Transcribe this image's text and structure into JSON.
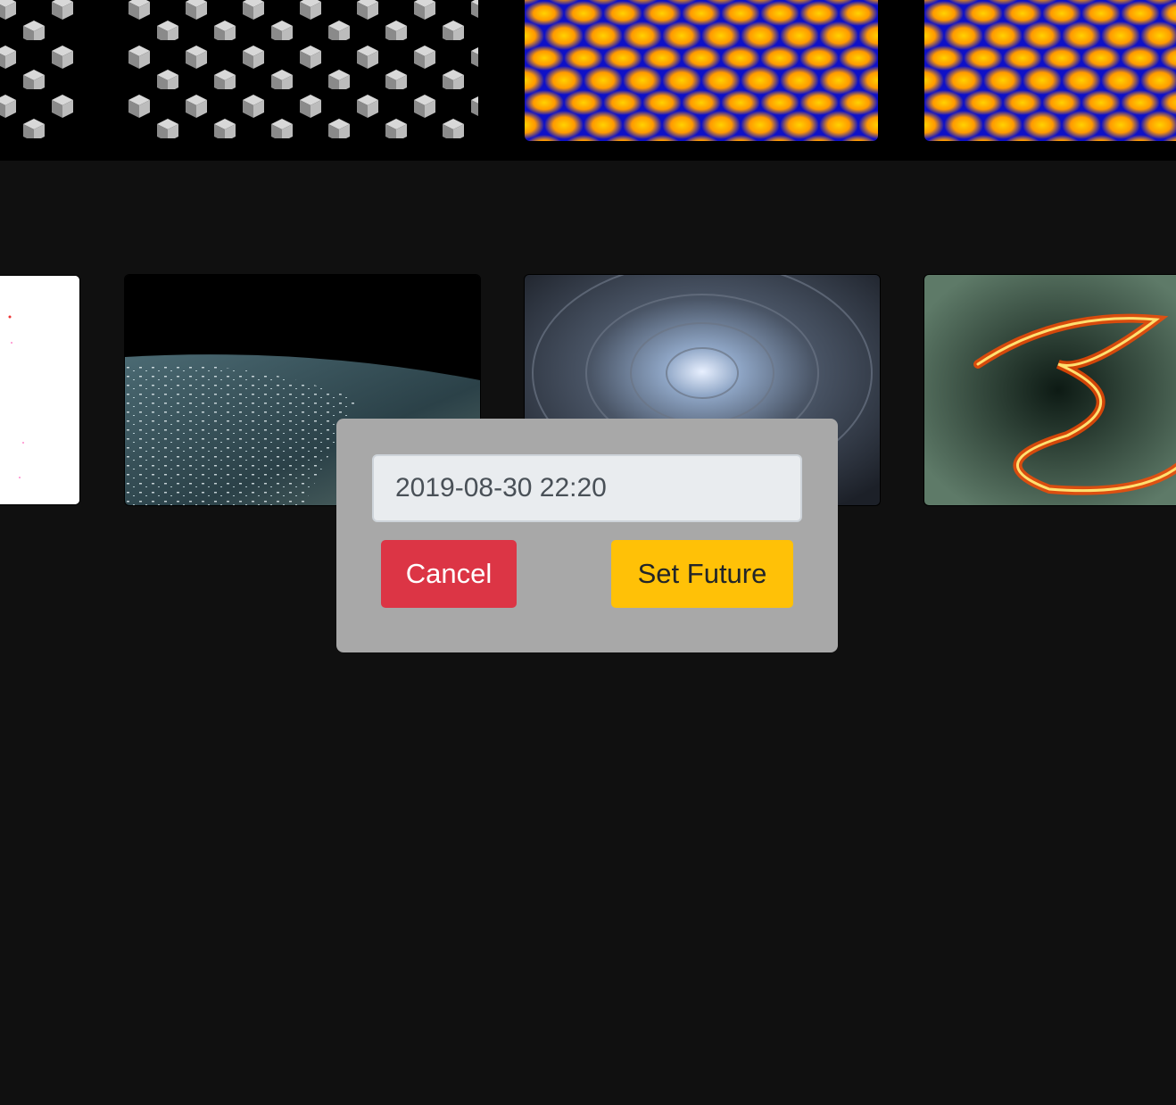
{
  "modal": {
    "date_value": "2019-08-30 22:20",
    "cancel_label": "Cancel",
    "set_future_label": "Set Future"
  },
  "colors": {
    "page_background": "#101010",
    "modal_background": "#a8a8a8",
    "cancel_button": "#dc3545",
    "set_future_button": "#ffc107"
  },
  "thumbnails": {
    "top_row": [
      "grey-cubes-pattern-image",
      "grey-cubes-pattern-image",
      "yellow-blue-lattice-image",
      "yellow-blue-lattice-image"
    ],
    "bottom_row": [
      "white-sparse-dots-image",
      "ocean-planet-image",
      "fractal-tunnel-image",
      "fire-ribbon-image"
    ]
  }
}
